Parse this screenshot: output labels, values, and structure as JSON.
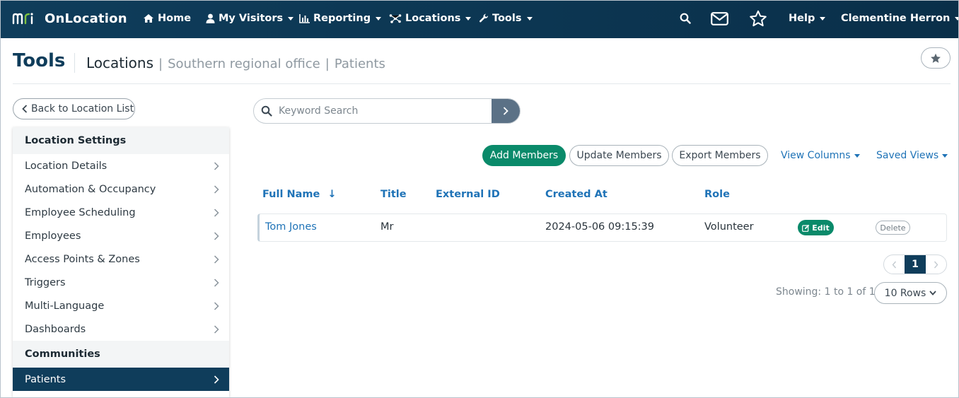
{
  "app": {
    "name": "OnLocation",
    "logo_text": "mri"
  },
  "nav": {
    "home": "Home",
    "visitors": "My Visitors",
    "reporting": "Reporting",
    "locations": "Locations",
    "tools": "Tools",
    "help": "Help",
    "user": "Clementine Herron"
  },
  "header": {
    "title": "Tools",
    "breadcrumb_main": "Locations",
    "breadcrumb_sep": "|",
    "breadcrumb_1": "Southern regional office",
    "breadcrumb_2": "Patients"
  },
  "sidebar": {
    "back_label": "Back to Location List",
    "section_settings": "Location Settings",
    "items": [
      "Location Details",
      "Automation & Occupancy",
      "Employee Scheduling",
      "Employees",
      "Access Points & Zones",
      "Triggers",
      "Multi-Language",
      "Dashboards"
    ],
    "section_communities": "Communities",
    "active_item": "Patients"
  },
  "search": {
    "placeholder": "Keyword Search"
  },
  "actions": {
    "add": "Add Members",
    "update": "Update Members",
    "export": "Export Members",
    "view_columns": "View Columns",
    "saved_views": "Saved Views"
  },
  "table": {
    "columns": {
      "full_name": "Full Name",
      "sort_indicator": "↓",
      "title": "Title",
      "external_id": "External ID",
      "created_at": "Created At",
      "role": "Role"
    },
    "rows": [
      {
        "full_name": "Tom Jones",
        "title": "Mr",
        "external_id": "",
        "created_at": "2024-05-06 09:15:39",
        "role": "Volunteer",
        "edit": "Edit",
        "delete": "Delete"
      }
    ]
  },
  "pagination": {
    "current_page": "1",
    "showing": "Showing: 1 to 1 of 1",
    "rows_per_page": "10 Rows"
  },
  "colors": {
    "navbar": "#0f3d5b",
    "accent_green": "#0a8a6a",
    "link_blue": "#1f73b7",
    "logo_green": "#7dc242"
  }
}
